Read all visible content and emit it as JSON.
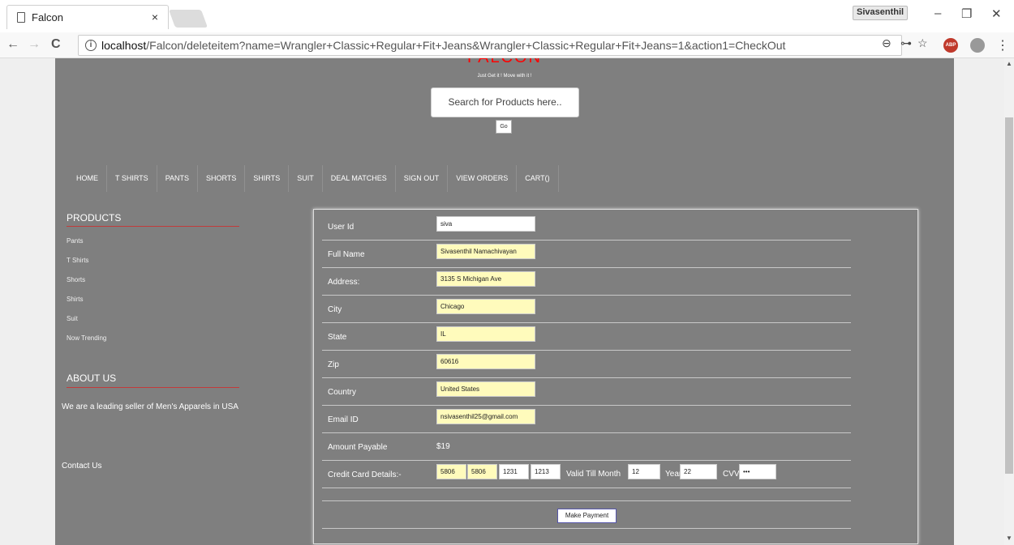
{
  "browser": {
    "tab_title": "Falcon",
    "tab_close": "×",
    "profile_name": "Sivasenthil",
    "minimize": "–",
    "restore": "❐",
    "close": "✕",
    "url_host": "localhost",
    "url_path": "/Falcon/deleteitem?name=Wrangler+Classic+Regular+Fit+Jeans&Wrangler+Classic+Regular+Fit+Jeans=1&action1=CheckOut",
    "back": "←",
    "forward": "→",
    "reload": "C",
    "info": "i",
    "zoom": "⊖",
    "key": "⊶",
    "star": "☆",
    "abp": "ABP",
    "menu": "⋮"
  },
  "site": {
    "logo": "FALCON",
    "tagline": "Just Get it ! Move with it !",
    "search_placeholder": "Search for Products here..",
    "go_label": "Go"
  },
  "nav": {
    "items": [
      "HOME",
      "T SHIRTS",
      "PANTS",
      "SHORTS",
      "SHIRTS",
      "SUIT",
      "DEAL MATCHES",
      "SIGN OUT",
      "VIEW ORDERS",
      "CART()"
    ]
  },
  "sidebar": {
    "products_heading": "PRODUCTS",
    "products": [
      "Pants",
      "T Shirts",
      "Shorts",
      "Shirts",
      "Suit",
      "Now Trending"
    ],
    "about_heading": "ABOUT US",
    "about_text": "We are a leading seller of Men's Apparels in USA",
    "contact": "Contact Us"
  },
  "form": {
    "fields": [
      {
        "label": "User Id",
        "value": "siva",
        "highlight": false
      },
      {
        "label": "Full Name",
        "value": "Sivasenthil Namachivayan",
        "highlight": true
      },
      {
        "label": "Address:",
        "value": "3135 S Michigan Ave",
        "highlight": true
      },
      {
        "label": "City",
        "value": "Chicago",
        "highlight": true
      },
      {
        "label": "State",
        "value": "IL",
        "highlight": true
      },
      {
        "label": "Zip",
        "value": "60616",
        "highlight": true
      },
      {
        "label": "Country",
        "value": "United States",
        "highlight": true
      },
      {
        "label": "Email ID",
        "value": "nsivasenthil25@gmail.com",
        "highlight": true
      }
    ],
    "amount_label": "Amount Payable",
    "amount_value": "$19",
    "cc_label": "Credit Card Details:-",
    "cc1": "5806",
    "cc2": "5806",
    "cc3": "1231",
    "cc4": "1213",
    "valid_label": "Valid Till Month",
    "month": "12",
    "year_label": "Year",
    "year": "22",
    "cvv_label": "CVV",
    "cvv": "•••",
    "submit_label": "Make Payment"
  }
}
